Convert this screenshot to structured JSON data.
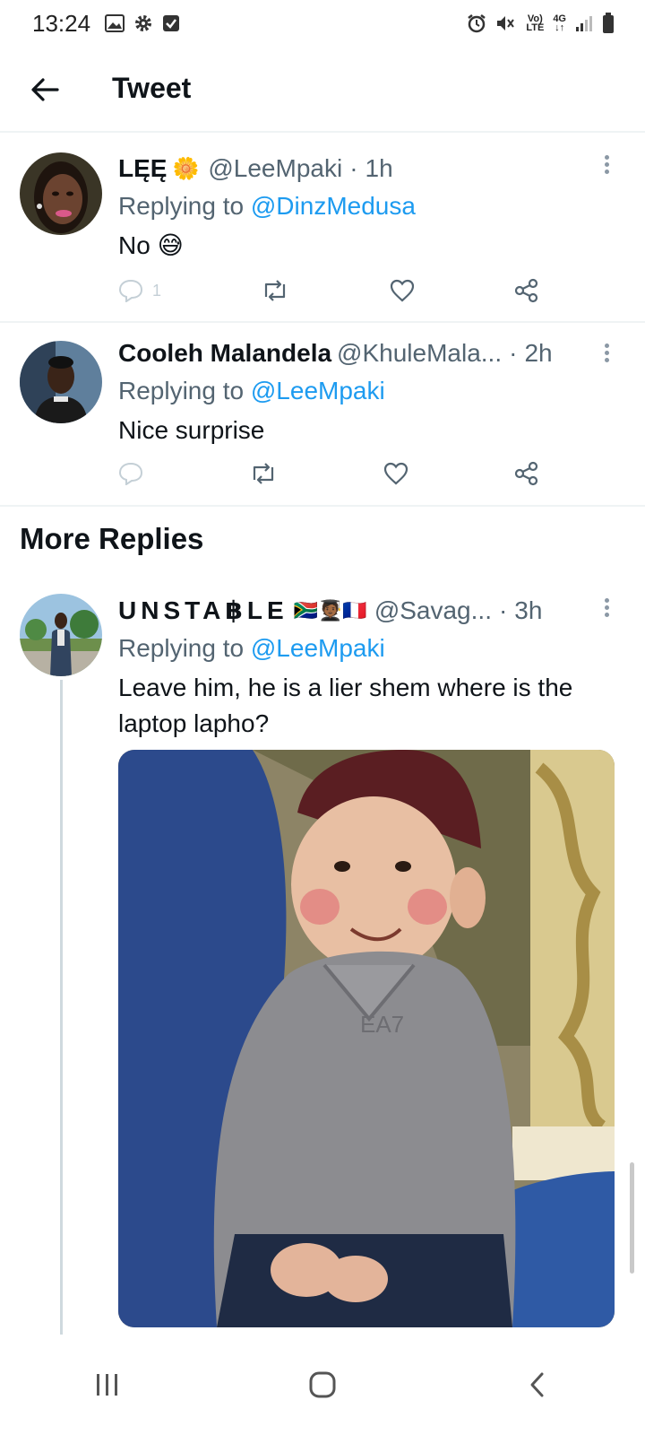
{
  "status_bar": {
    "time": "13:24",
    "icons_left": [
      "image-icon",
      "gear-icon",
      "checkbox-icon"
    ],
    "icons_right": [
      "alarm-icon",
      "mute-icon",
      "volte-icon",
      "4g-icon",
      "signal-icon",
      "battery-icon"
    ],
    "volte_top": "Vo)",
    "volte_bottom": "LTE",
    "net_top": "4G",
    "net_bottom": "↓↑"
  },
  "header": {
    "title": "Tweet"
  },
  "tweets": [
    {
      "name": "LĘĘ",
      "name_emoji": "🌼",
      "handle": "@LeeMpaki",
      "time": "1h",
      "replying_prefix": "Replying to",
      "replying_to": "@DinzMedusa",
      "text": "No 😅",
      "reply_count": "1"
    },
    {
      "name": "Cooleh Malandela",
      "handle": "@KhuleMala...",
      "time": "2h",
      "replying_prefix": "Replying to",
      "replying_to": "@LeeMpaki",
      "text": "Nice surprise",
      "reply_count": ""
    }
  ],
  "more_replies": {
    "title": "More Replies",
    "tweet": {
      "name": "UNSTA฿LE",
      "name_emoji": "🇿🇦🧑🏾‍🎓🇫🇷",
      "handle": "@Savag...",
      "time": "3h",
      "replying_prefix": "Replying to",
      "replying_to": "@LeeMpaki",
      "text": "Leave him, he is a lier shem where is the laptop lapho?",
      "media_shirt_text": "EA7"
    }
  },
  "nav": [
    "recent-apps-icon",
    "home-icon",
    "back-icon"
  ]
}
